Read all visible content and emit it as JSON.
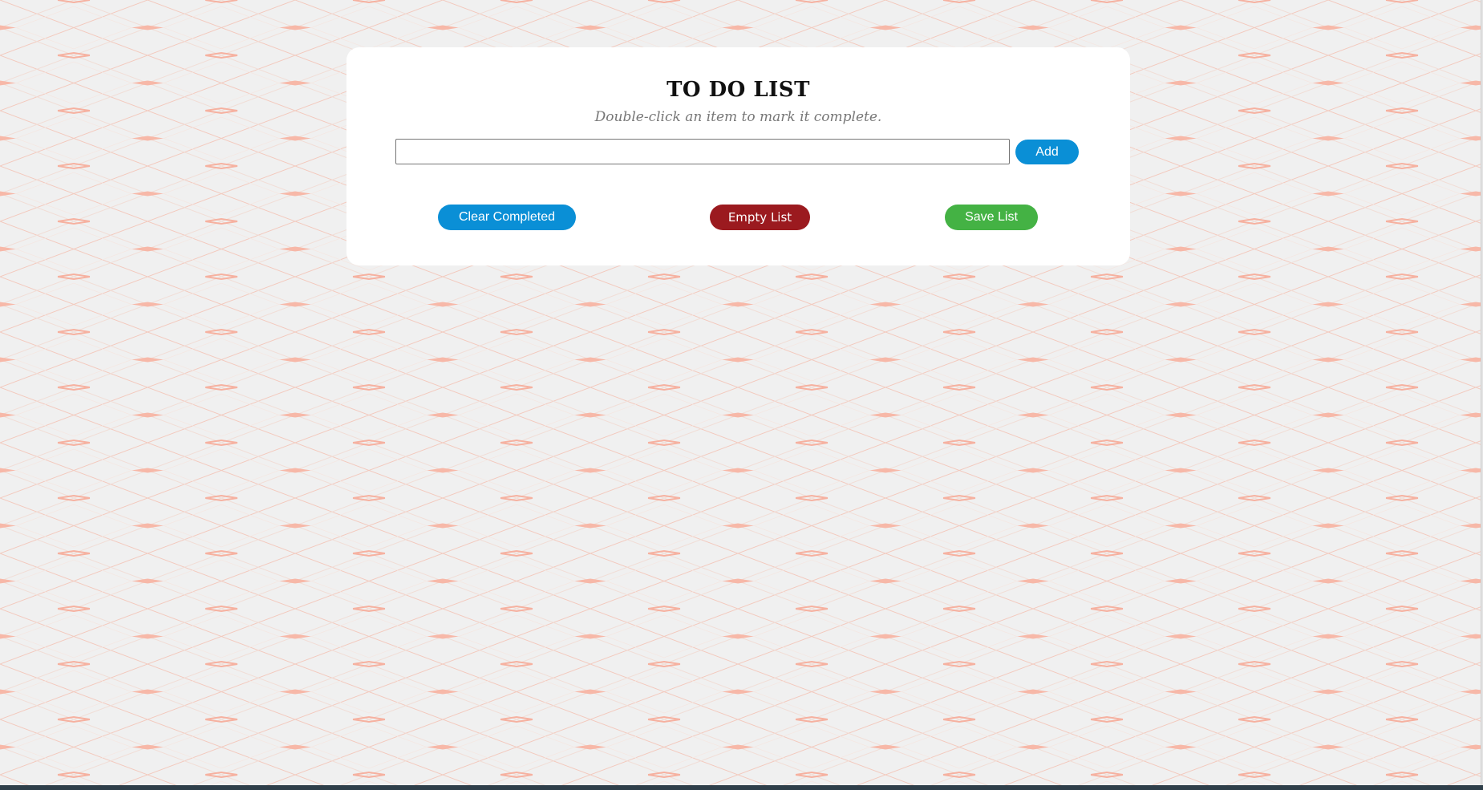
{
  "app": {
    "title": "TO DO LIST",
    "subtitle": "Double-click an item to mark it complete."
  },
  "task_entry": {
    "value": "",
    "placeholder": "",
    "add_label": "Add"
  },
  "actions": {
    "clear_label": "Clear Completed",
    "empty_label": "Empty List",
    "save_label": "Save List"
  },
  "colors": {
    "page_background": "#f0f0f0",
    "pattern_accent": "#f7b3a3",
    "card_background": "#ffffff",
    "add_button": "#0a8fd6",
    "clear_button": "#0a8fd6",
    "empty_button": "#9b1a1f",
    "save_button": "#44b244"
  }
}
